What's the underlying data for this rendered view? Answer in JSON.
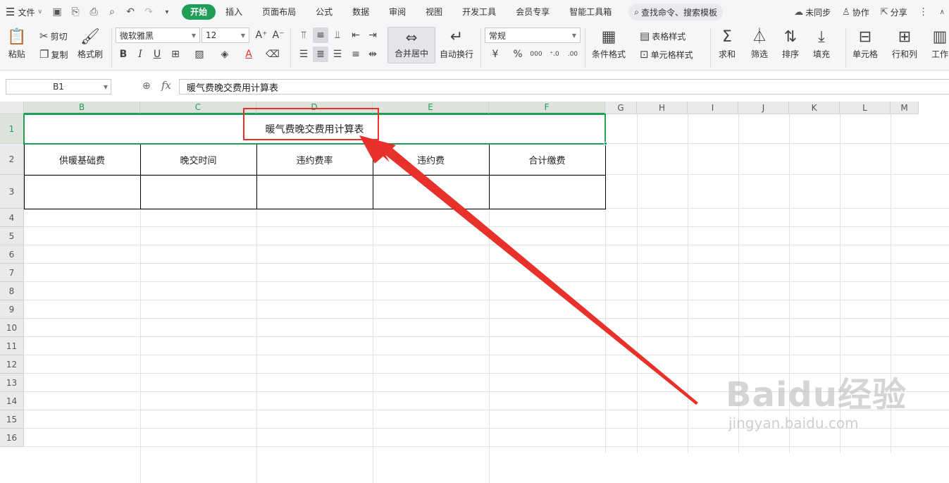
{
  "menubar": {
    "file_label": "文件",
    "tabs": [
      "开始",
      "插入",
      "页面布局",
      "公式",
      "数据",
      "审阅",
      "视图",
      "开发工具",
      "会员专享",
      "智能工具箱"
    ],
    "active_tab": "开始",
    "search_label": "查找命令、搜索模板",
    "right": {
      "sync": "未同步",
      "collab": "协作",
      "share": "分享"
    }
  },
  "ribbon": {
    "paste": "粘贴",
    "cut": "剪切",
    "copy": "复制",
    "format_painter": "格式刷",
    "font_name": "微软雅黑",
    "font_size": "12",
    "merge_center": "合并居中",
    "wrap_text": "自动换行",
    "number_format": "常规",
    "conditional_format": "条件格式",
    "table_style": "表格样式",
    "cell_style": "单元格样式",
    "sum": "求和",
    "filter": "筛选",
    "sort": "排序",
    "fill": "填充",
    "cell": "单元格",
    "row_col": "行和列",
    "worksheet": "工作"
  },
  "formula_bar": {
    "cell_ref": "B1",
    "fx": "fx",
    "value": "暖气费晚交费用计算表"
  },
  "grid": {
    "columns": [
      "B",
      "C",
      "D",
      "E",
      "F",
      "G",
      "H",
      "I",
      "J",
      "K",
      "L",
      "M"
    ],
    "rows": [
      "1",
      "2",
      "3",
      "4",
      "5",
      "6",
      "7",
      "8",
      "9",
      "10",
      "11",
      "12",
      "13",
      "14",
      "15",
      "16"
    ],
    "title": "暖气费晚交费用计算表",
    "headers": [
      "供暖基础费",
      "晚交时间",
      "违约费率",
      "违约费",
      "合计缴费"
    ]
  },
  "watermark": {
    "main": "Baidu经验",
    "sub": "jingyan.baidu.com"
  },
  "colors": {
    "accent": "#1e9e57",
    "highlight": "#e8312a"
  }
}
